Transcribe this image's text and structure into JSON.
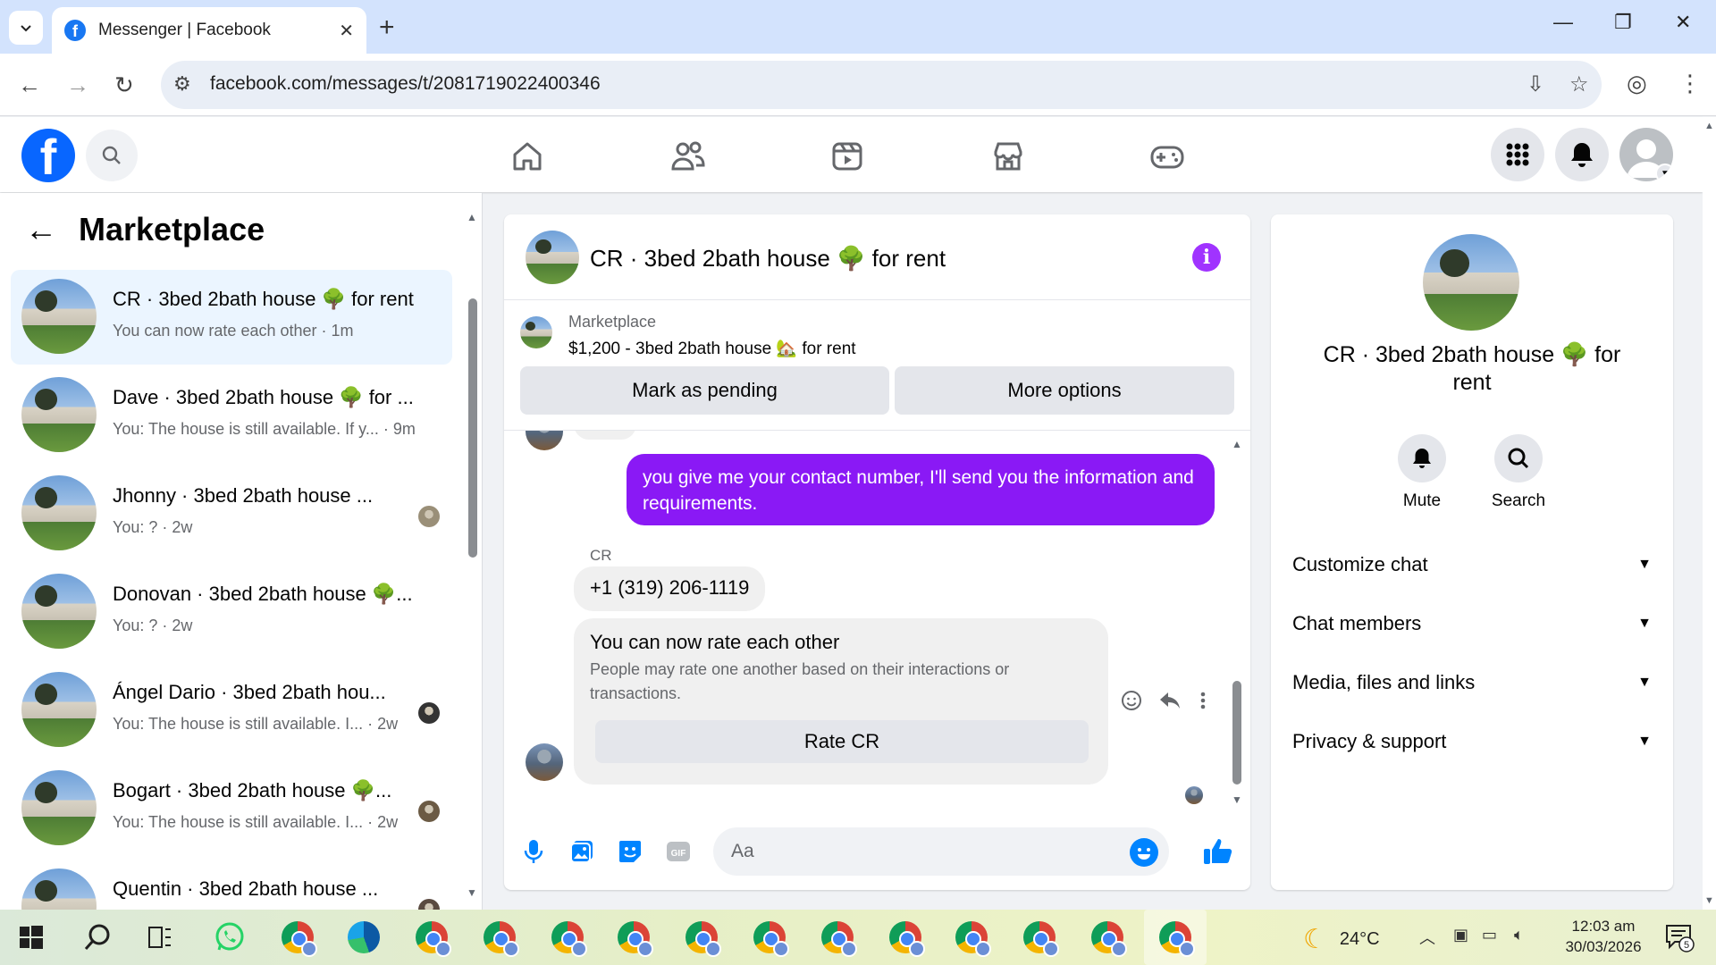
{
  "browser": {
    "tab_title": "Messenger | Facebook",
    "url": "facebook.com/messages/t/2081719022400346"
  },
  "left_panel": {
    "title": "Marketplace",
    "chats": [
      {
        "name": "CR · 3bed 2bath house 🌳 for rent",
        "preview": "You can now rate each other · 1m",
        "active": true
      },
      {
        "name": "Dave · 3bed 2bath house 🌳 for ...",
        "preview": "You: The house is still available. If y... · 9m",
        "active": false
      },
      {
        "name": "Jhonny · 3bed 2bath house ...",
        "preview": "You: ? · 2w",
        "active": false
      },
      {
        "name": "Donovan · 3bed 2bath house 🌳...",
        "preview": "You: ? · 2w",
        "active": false
      },
      {
        "name": "Ángel Dario · 3bed 2bath hou...",
        "preview": "You: The house is still available. I... · 2w",
        "active": false
      },
      {
        "name": "Bogart · 3bed 2bath house 🌳...",
        "preview": "You: The house is still available. I... · 2w",
        "active": false
      },
      {
        "name": "Quentin · 3bed 2bath house ...",
        "preview": "You: The house is still available. I... · 2w",
        "active": false
      }
    ]
  },
  "conversation": {
    "title": "CR · 3bed 2bath house 🌳 for rent",
    "listing": {
      "source": "Marketplace",
      "price_title": "$1,200 - 3bed 2bath house 🏡 for rent",
      "mark_pending_label": "Mark as pending",
      "more_options_label": "More options"
    },
    "outgoing_message": "you give me your contact number, I'll send you the information and requirements.",
    "sender_name": "CR",
    "incoming_message": "+1 (319) 206-1119",
    "rate_card": {
      "title": "You can now rate each other",
      "description": "People may rate one another based on their interactions or transactions.",
      "button_label": "Rate CR"
    },
    "composer_placeholder": "Aa"
  },
  "details_panel": {
    "name": "CR · 3bed 2bath house 🌳 for rent",
    "mute_label": "Mute",
    "search_label": "Search",
    "sections": [
      "Customize chat",
      "Chat members",
      "Media, files and links",
      "Privacy & support"
    ]
  },
  "taskbar": {
    "temperature": "24°C",
    "time": "12:03 am",
    "date": "30/03/2026",
    "notification_count": "5"
  },
  "colors": {
    "fb_blue": "#0866ff",
    "messenger_purple": "#8a19f5",
    "active_chat_bg": "#ebf5ff"
  }
}
